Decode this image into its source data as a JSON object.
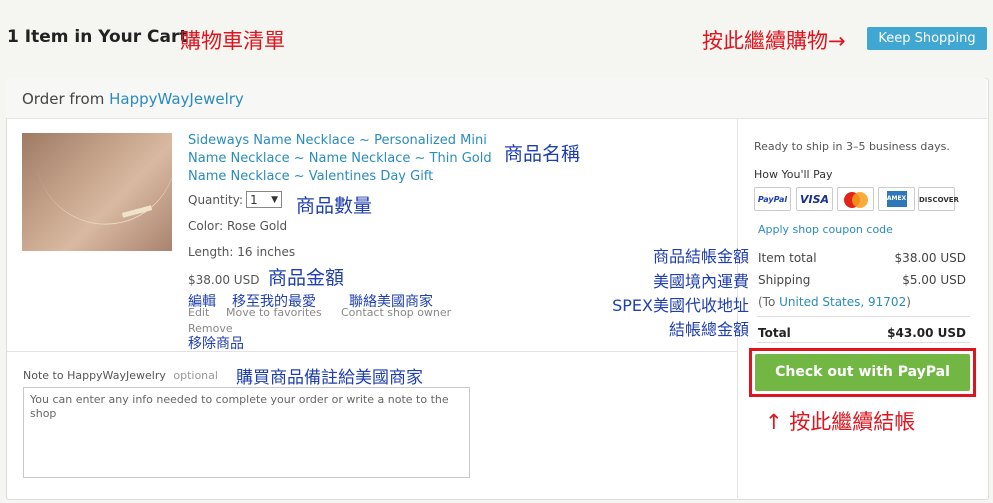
{
  "header": {
    "cart_title": "1 Item in Your Cart",
    "cart_title_cn": "購物車清單",
    "keep_note_cn": "按此繼續購物→",
    "keep_button": "Keep Shopping"
  },
  "order": {
    "order_from_label": "Order from",
    "shop_name": "HappyWayJewelry"
  },
  "product": {
    "name_line1": "Sideways Name Necklace ~ Personalized Mini",
    "name_line2": "Name Necklace ~ Name Necklace ~ Thin Gold",
    "name_line3": "Name Necklace ~ Valentines Day Gift",
    "name_cn": "商品名稱",
    "quantity_label": "Quantity:",
    "quantity_value": "1",
    "quantity_cn": "商品數量",
    "color": "Color: Rose Gold",
    "length": "Length: 16 inches",
    "price": "$38.00 USD",
    "price_cn": "商品金額",
    "edit_cn": "編輯",
    "move_cn": "移至我的最愛",
    "contact_cn": "聯絡美國商家",
    "edit": "Edit",
    "move": "Move to favorites",
    "contact": "Contact shop owner",
    "remove": "Remove",
    "remove_cn": "移除商品"
  },
  "note": {
    "label": "Note to HappyWayJewelry",
    "optional": "optional",
    "label_cn": "購買商品備註給美國商家",
    "placeholder": "You can enter any info needed to complete your order or write a note to the shop"
  },
  "annotations_cn": {
    "item_total": "商品結帳金額",
    "shipping": "美國境內運費",
    "address": "SPEX美國代收地址",
    "total": "結帳總金額",
    "checkout": "↑ 按此繼續結帳"
  },
  "summary": {
    "ship_note": "Ready to ship in 3–5 business days.",
    "how_pay": "How You'll Pay",
    "cards": [
      "PayPal",
      "VISA",
      "MasterCard",
      "AMEX",
      "DISCOVER"
    ],
    "coupon": "Apply shop coupon code",
    "item_total_label": "Item total",
    "item_total_value": "$38.00 USD",
    "shipping_label": "Shipping",
    "shipping_value": "$5.00 USD",
    "ship_to_prefix": "(To ",
    "ship_to_link": "United States, 91702",
    "ship_to_suffix": ")",
    "total_label": "Total",
    "total_value": "$43.00 USD",
    "checkout_button": "Check out with PayPal"
  },
  "colors": {
    "link": "#2a8bbf",
    "annotation_red": "#e0141e",
    "annotation_blue": "#1f3fae",
    "checkout_green": "#72b644",
    "keep_blue": "#3fa7d1"
  }
}
